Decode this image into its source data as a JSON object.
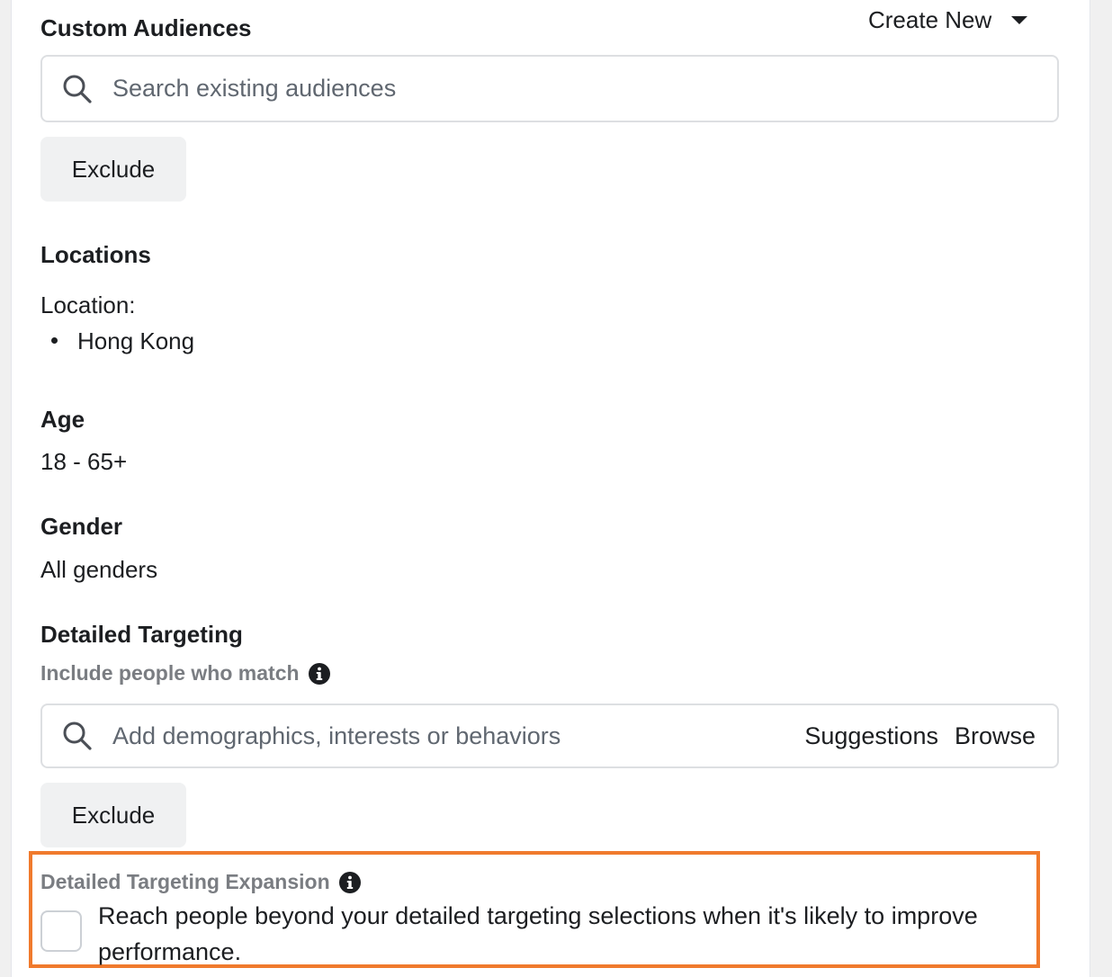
{
  "custom_audiences": {
    "title": "Custom Audiences",
    "create_new_label": "Create New",
    "search_placeholder": "Search existing audiences",
    "exclude_label": "Exclude"
  },
  "locations": {
    "title": "Locations",
    "location_label": "Location:",
    "items": [
      "Hong Kong"
    ]
  },
  "age": {
    "title": "Age",
    "value": "18 - 65+"
  },
  "gender": {
    "title": "Gender",
    "value": "All genders"
  },
  "detailed_targeting": {
    "title": "Detailed Targeting",
    "include_label": "Include people who match",
    "search_placeholder": "Add demographics, interests or behaviors",
    "suggestions_label": "Suggestions",
    "browse_label": "Browse",
    "exclude_label": "Exclude"
  },
  "expansion": {
    "title": "Detailed Targeting Expansion",
    "checkbox_text": "Reach people beyond your detailed targeting selections when it's likely to improve performance.",
    "checked": false
  },
  "icons": {
    "search": "search-icon",
    "caret": "caret-down-icon",
    "info": "info-icon"
  },
  "colors": {
    "highlight": "#f07a2d",
    "muted_label": "#7a7d82",
    "button_bg": "#f0f1f2"
  }
}
